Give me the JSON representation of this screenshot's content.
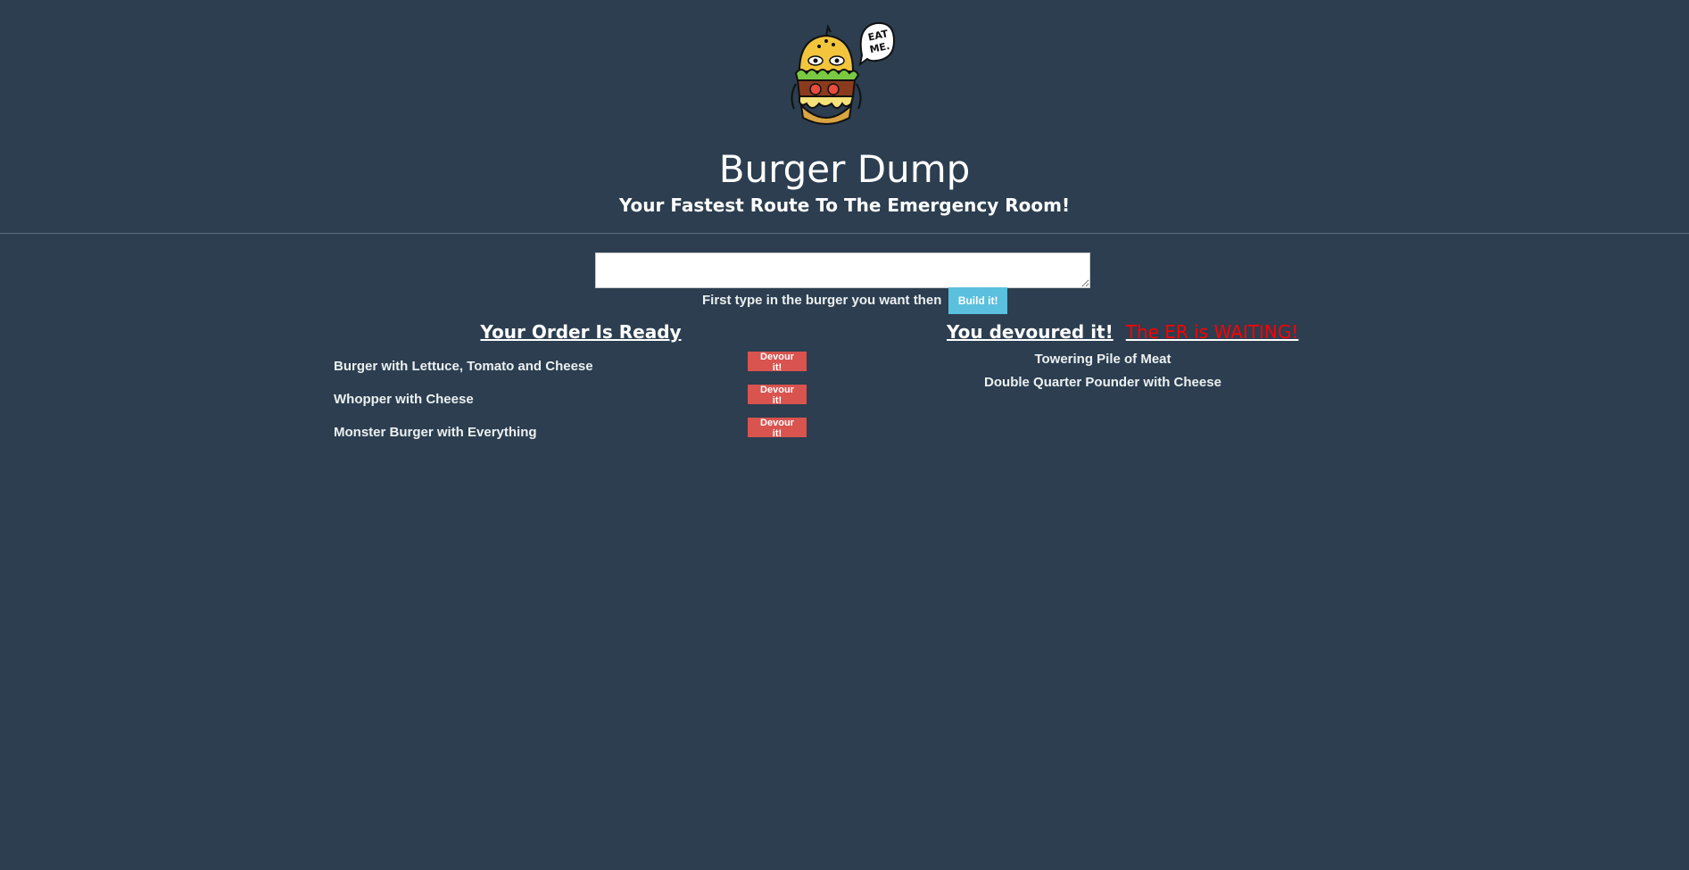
{
  "header": {
    "logo_text": "EAT ME.",
    "title": "Burger Dump",
    "subtitle": "Your Fastest Route To The Emergency Room!"
  },
  "form": {
    "input_value": "",
    "hint": "First type in the burger you want then",
    "button_label": "Build it!"
  },
  "orders": {
    "heading": "Your Order Is Ready",
    "button_label": "Devour it!",
    "items": [
      "Burger with Lettuce, Tomato and Cheese",
      "Whopper with Cheese",
      "Monster Burger with Everything"
    ]
  },
  "devoured": {
    "heading": "You devoured it!",
    "warning": "The ER is WAITING!",
    "items": [
      "Towering Pile of Meat",
      "Double Quarter Pounder with Cheese"
    ]
  },
  "colors": {
    "background": "#2c3e50",
    "build_button": "#5bc0de",
    "devour_button": "#d9534f",
    "warning": "#ff0000"
  }
}
